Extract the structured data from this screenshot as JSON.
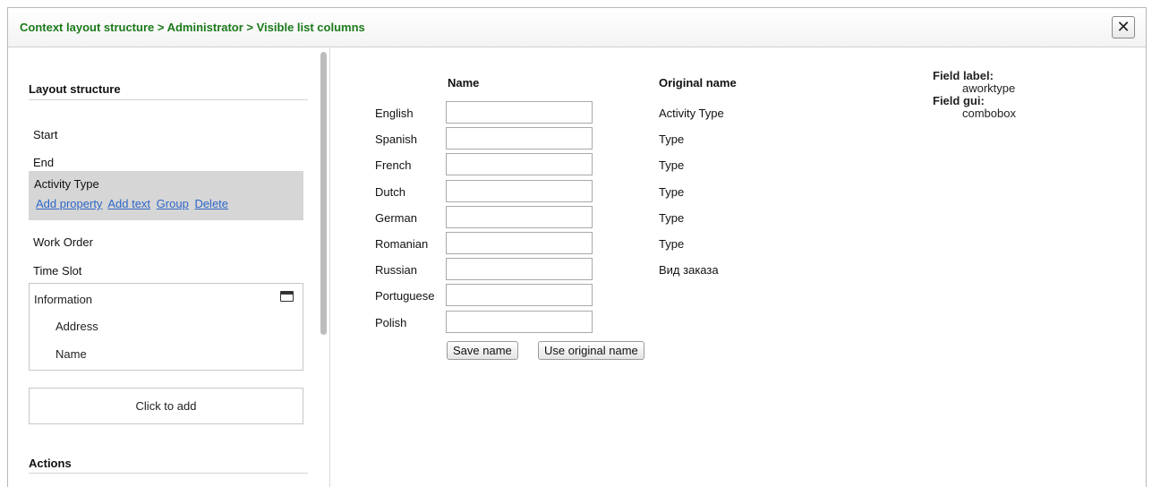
{
  "header": {
    "breadcrumb": "Context layout structure > Administrator > Visible list columns",
    "close_label": "✕"
  },
  "sidebar": {
    "layout_title": "Layout structure",
    "items": [
      "Start",
      "End"
    ],
    "selected": {
      "label": "Activity Type",
      "links": [
        "Add property",
        "Add text",
        "Group",
        "Delete"
      ]
    },
    "items_after": [
      "Work Order",
      "Time Slot"
    ],
    "info_box": {
      "title": "Information",
      "children": [
        "Address",
        "Name"
      ]
    },
    "add_label": "Click to add",
    "actions_title": "Actions"
  },
  "main": {
    "name_header": "Name",
    "original_header": "Original name",
    "rows": [
      {
        "language": "English",
        "value": "",
        "original": "Activity Type"
      },
      {
        "language": "Spanish",
        "value": "",
        "original": "Type"
      },
      {
        "language": "French",
        "value": "",
        "original": "Type"
      },
      {
        "language": "Dutch",
        "value": "",
        "original": "Type"
      },
      {
        "language": "German",
        "value": "",
        "original": "Type"
      },
      {
        "language": "Romanian",
        "value": "",
        "original": "Type"
      },
      {
        "language": "Russian",
        "value": "",
        "original": "Вид заказа"
      },
      {
        "language": "Portuguese",
        "value": "",
        "original": ""
      },
      {
        "language": "Polish",
        "value": "",
        "original": ""
      }
    ],
    "save_button": "Save name",
    "use_original_button": "Use original name",
    "field_label_key": "Field label:",
    "field_label_value": "aworktype",
    "field_gui_key": "Field gui:",
    "field_gui_value": "combobox"
  }
}
